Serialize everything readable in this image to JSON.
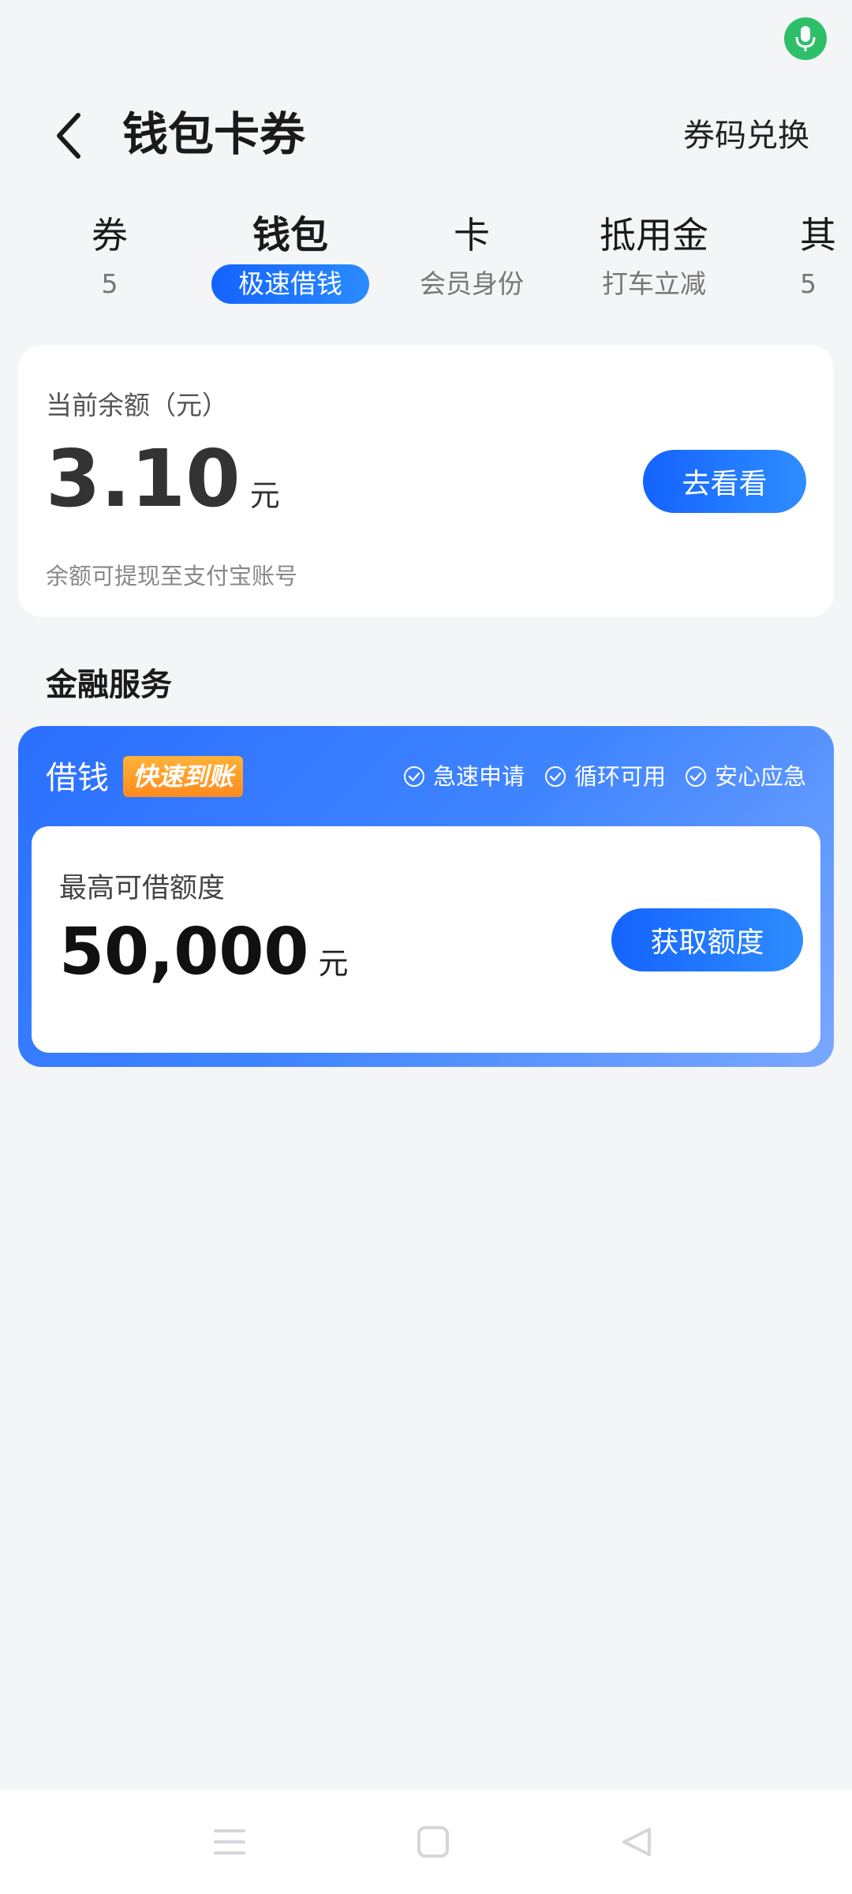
{
  "status": {
    "mic_icon": "microphone-icon",
    "mic_color": "#2fbf6a"
  },
  "header": {
    "back_icon": "chevron-left-icon",
    "title": "钱包卡券",
    "exchange_label": "券码兑换"
  },
  "tabs": [
    {
      "title": "券",
      "sub": "5",
      "active": false
    },
    {
      "title": "钱包",
      "sub": "极速借钱",
      "active": true
    },
    {
      "title": "卡",
      "sub": "会员身份",
      "active": false
    },
    {
      "title": "抵用金",
      "sub": "打车立减",
      "active": false
    },
    {
      "title": "其",
      "sub": "5",
      "active": false
    }
  ],
  "balance": {
    "label": "当前余额（元）",
    "amount": "3.10",
    "unit": "元",
    "button_label": "去看看",
    "note": "余额可提现至支付宝账号"
  },
  "finance": {
    "section_title": "金融服务",
    "loan_title": "借钱",
    "badge": "快速到账",
    "features": [
      "急速申请",
      "循环可用",
      "安心应急"
    ],
    "limit_label": "最高可借额度",
    "limit_amount": "50,000",
    "limit_unit": "元",
    "button_label": "获取额度"
  },
  "colors": {
    "accent": "#1463ff",
    "badge_orange": "#ff8a1f",
    "background": "#f4f5f7"
  },
  "navbar": {
    "items": [
      "menu-icon",
      "home-square-icon",
      "back-triangle-icon"
    ]
  }
}
